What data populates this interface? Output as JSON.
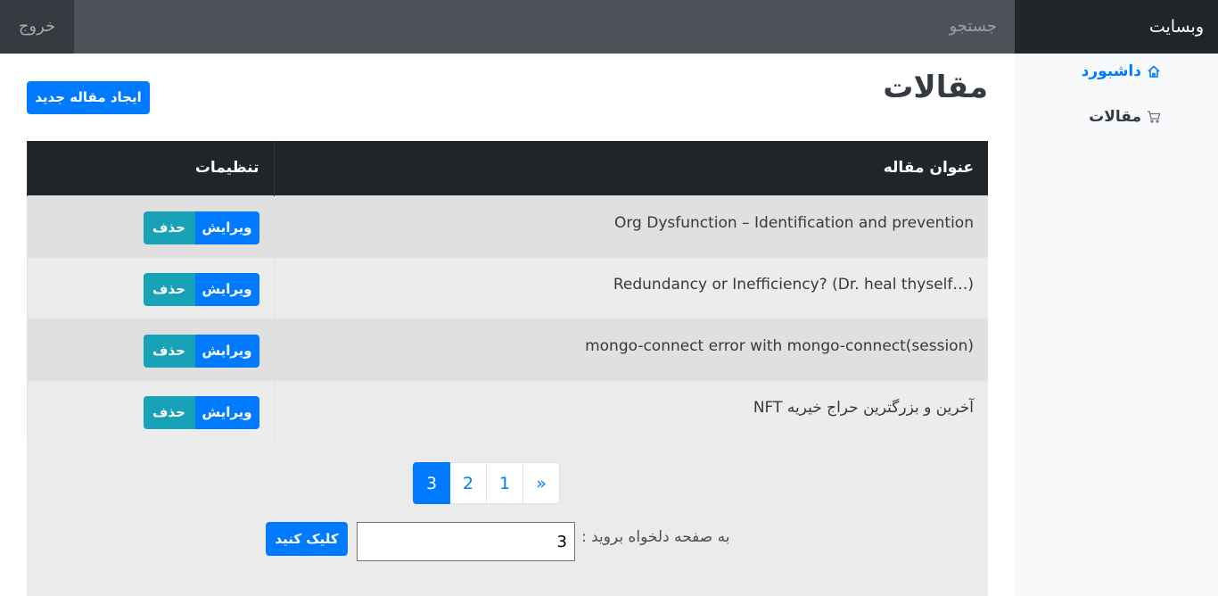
{
  "navbar": {
    "brand": "وبسایت",
    "search_placeholder": "جستجو",
    "logout": "خروج"
  },
  "sidebar": {
    "items": [
      {
        "label": "داشبورد",
        "icon": "home-icon",
        "active": true
      },
      {
        "label": "مقالات",
        "icon": "cart-icon",
        "active": false
      }
    ]
  },
  "main": {
    "title": "مقالات",
    "new_button": "ایجاد مقاله جدید",
    "table": {
      "headers": [
        "عنوان مقاله",
        "تنظیمات"
      ],
      "rows": [
        {
          "title": "Org Dysfunction – Identification and prevention",
          "edit": "ویرایش",
          "delete": "حذف"
        },
        {
          "title": "Redundancy or Inefficiency? (Dr. heal thyself…)",
          "edit": "ویرایش",
          "delete": "حذف"
        },
        {
          "title": "mongo-connect error with mongo-connect(session)",
          "edit": "ویرایش",
          "delete": "حذف"
        },
        {
          "title": "آخرین و بزرگترین حراج خیریه NFT",
          "edit": "ویرایش",
          "delete": "حذف"
        }
      ]
    },
    "pagination": {
      "pages": [
        "«",
        "1",
        "2",
        "3"
      ],
      "active": "3"
    },
    "goto": {
      "label": "به صفحه دلخواه بروید :",
      "value": "3",
      "button": "کلیک کنید"
    }
  },
  "colors": {
    "primary": "#007bff",
    "info": "#17a2b8",
    "dark": "#212529"
  }
}
